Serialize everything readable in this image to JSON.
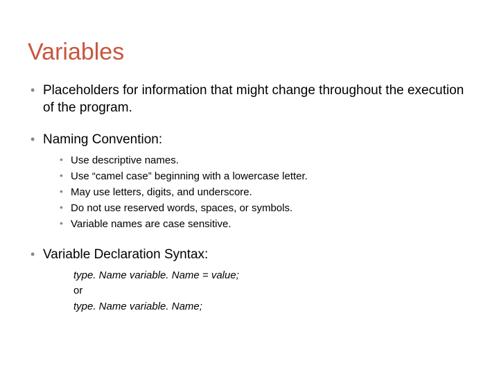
{
  "title": "Variables",
  "items": [
    {
      "text": "Placeholders for information that might change throughout the execution of the program."
    },
    {
      "text": "Naming Convention:",
      "sub": [
        "Use descriptive names.",
        "Use “camel case” beginning with a lowercase letter.",
        "May use letters, digits, and underscore.",
        "Do not use reserved words, spaces, or symbols.",
        "Variable names are case sensitive."
      ]
    },
    {
      "text": "Variable Declaration Syntax:",
      "syntax": {
        "line1": "type. Name variable. Name = value;",
        "or": "or",
        "line2": "type. Name variable. Name;"
      }
    }
  ]
}
